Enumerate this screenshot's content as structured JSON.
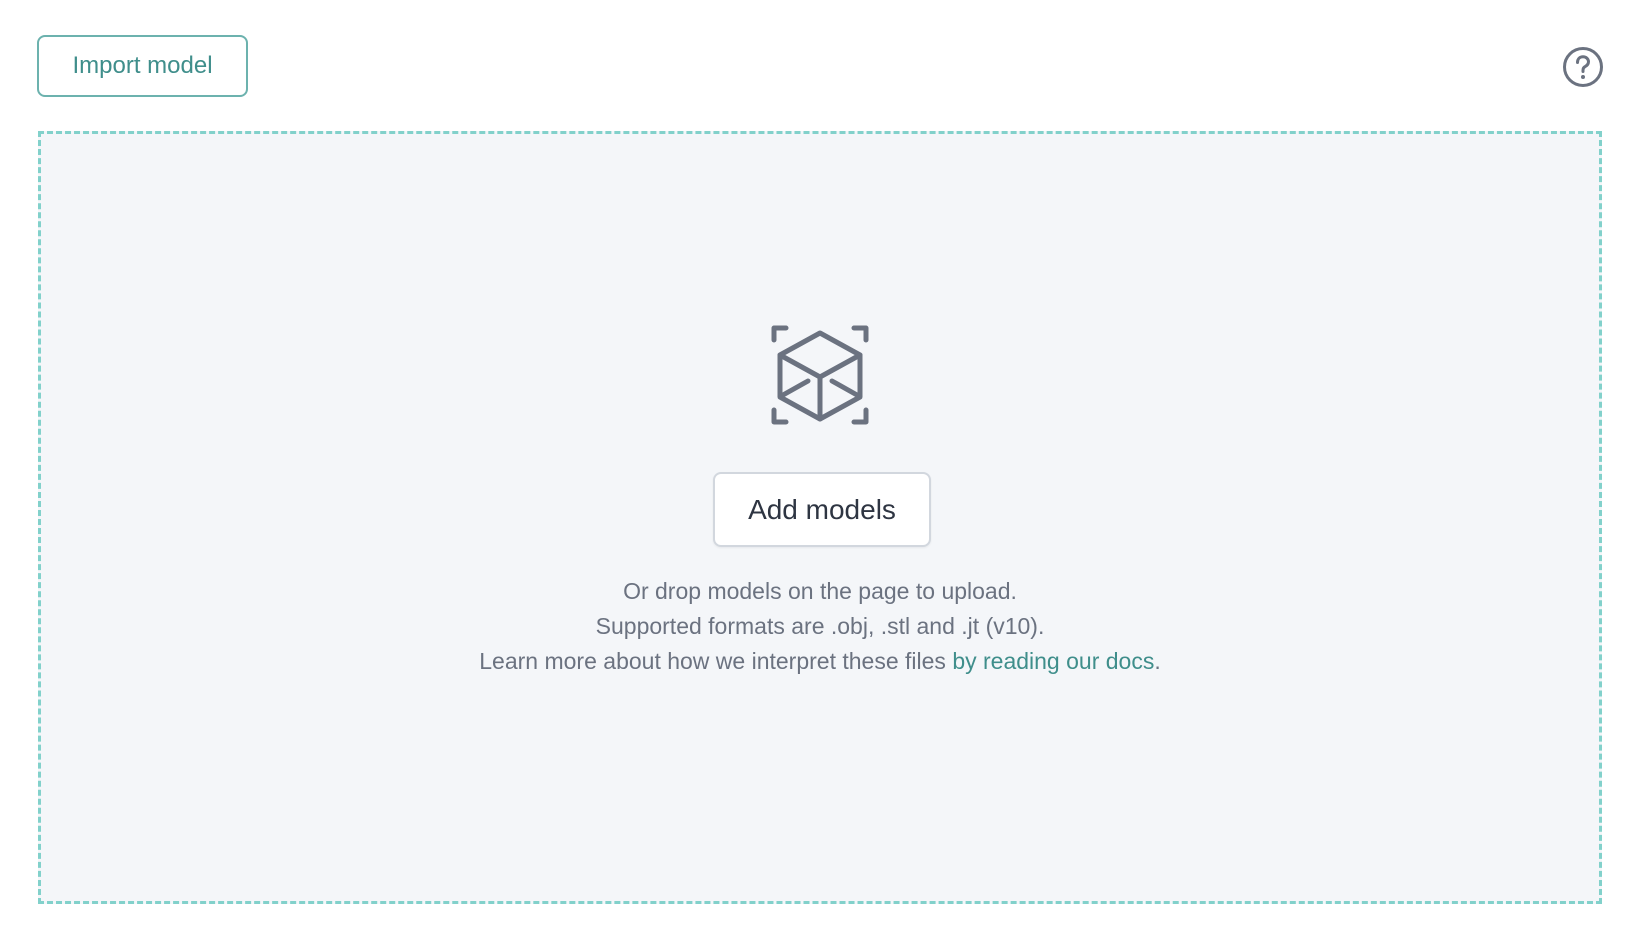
{
  "toolbar": {
    "import_label": "Import model",
    "help_icon": "question-circle-icon"
  },
  "dropzone": {
    "icon": "cube-scan-icon",
    "add_label": "Add models",
    "line1": "Or drop models on the page to upload.",
    "line2": "Supported formats are .obj, .stl and .jt (v10).",
    "line3_prefix": "Learn more about how we interpret these files ",
    "docs_link": "by reading our docs",
    "line3_suffix": "."
  },
  "colors": {
    "accent": "#3f8e8b",
    "accent_border": "#6cb2ae",
    "dashed_border": "#82d1cb",
    "dropzone_bg": "#f4f6f9",
    "icon_gray": "#6b7280"
  }
}
